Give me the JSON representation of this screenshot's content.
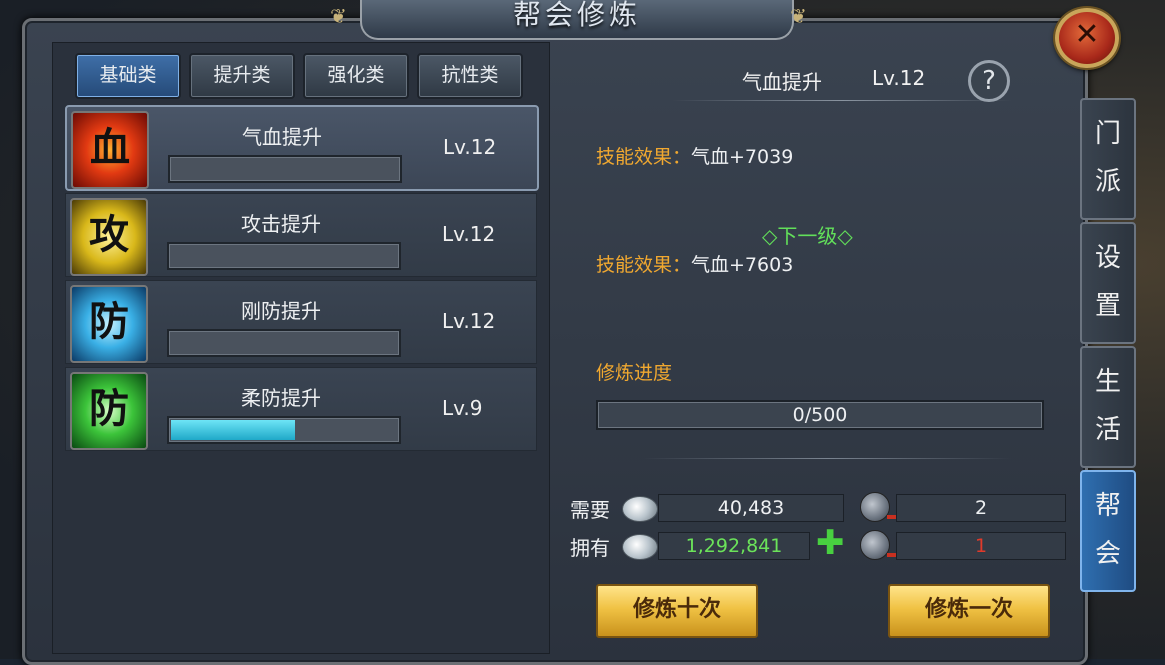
{
  "title": "帮会修炼",
  "tabs": [
    "基础类",
    "提升类",
    "强化类",
    "抗性类"
  ],
  "skills": [
    {
      "icon_char": "血",
      "name": "气血提升",
      "level": "Lv.12",
      "progress": 0
    },
    {
      "icon_char": "攻",
      "name": "攻击提升",
      "level": "Lv.12",
      "progress": 0
    },
    {
      "icon_char": "防",
      "name": "刚防提升",
      "level": "Lv.12",
      "progress": 0
    },
    {
      "icon_char": "防",
      "name": "柔防提升",
      "level": "Lv.9",
      "progress": 0.55
    }
  ],
  "detail": {
    "name": "气血提升",
    "level": "Lv.12",
    "help": "?",
    "effect_label": "技能效果：",
    "current_effect": "气血+7039",
    "next_level_label": "◇下一级◇",
    "next_effect": "气血+7603",
    "progress_label": "修炼进度",
    "progress_text": "0/500"
  },
  "cost": {
    "need_label": "需要",
    "have_label": "拥有",
    "need_silver": "40,483",
    "have_silver": "1,292,841",
    "need_token": "2",
    "have_token": "1",
    "plus": "✚"
  },
  "buttons": {
    "train_ten": "修炼十次",
    "train_once": "修炼一次"
  },
  "side_tabs": [
    "门派",
    "设置",
    "生活",
    "帮会"
  ],
  "colors": {
    "accent_blue": "#2f6fb0",
    "label_orange": "#f0a830",
    "next_green": "#62e05a",
    "have_green": "#6be35a",
    "warn_red": "#e03a2a"
  }
}
